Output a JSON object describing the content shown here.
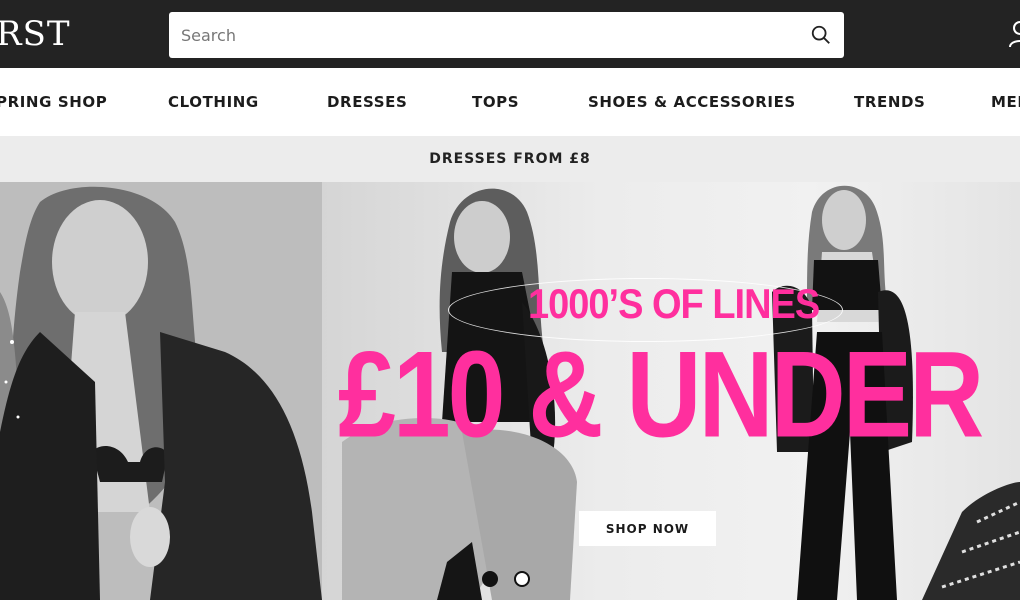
{
  "header": {
    "logo_text": "RST",
    "search": {
      "placeholder": "Search",
      "value": ""
    }
  },
  "nav": {
    "items": [
      {
        "label": "PRING SHOP"
      },
      {
        "label": "CLOTHING"
      },
      {
        "label": "DRESSES"
      },
      {
        "label": "TOPS"
      },
      {
        "label": "SHOES & ACCESSORIES"
      },
      {
        "label": "TRENDS"
      },
      {
        "label": "MEN"
      }
    ]
  },
  "promo": {
    "text": "DRESSES FROM £8"
  },
  "hero": {
    "headline_small": "1000’S OF LINES",
    "headline_big": "£10 & UNDER",
    "cta_label": "SHOP NOW",
    "carousel": {
      "slides": 2,
      "active_slide": 1
    }
  },
  "colors": {
    "header_bg": "#232323",
    "accent_pink": "#ff2f9e",
    "promo_bg": "#ececec"
  },
  "icons": [
    "search-icon",
    "user-icon"
  ]
}
